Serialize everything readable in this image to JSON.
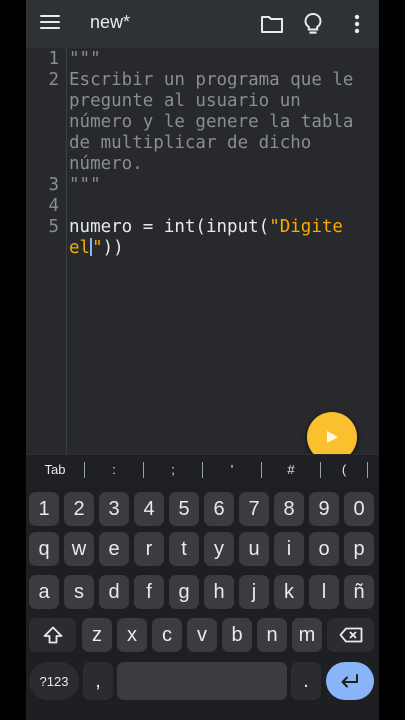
{
  "app": {
    "title": "new*",
    "icons": [
      "menu-icon",
      "folder-icon",
      "lightbulb-icon",
      "more-vert-icon"
    ]
  },
  "editor": {
    "lines": [
      {
        "n": "1",
        "text": "\"\"\""
      },
      {
        "n": "2",
        "text": "Escribir un programa que le"
      },
      {
        "n": "",
        "text": "pregunte al usuario un"
      },
      {
        "n": "",
        "text": "número y le genere la tabla"
      },
      {
        "n": "",
        "text": "de multiplicar de dicho"
      },
      {
        "n": "",
        "text": "número."
      },
      {
        "n": "3",
        "text": "\"\"\""
      },
      {
        "n": "4",
        "text": ""
      },
      {
        "n": "5",
        "text": ""
      }
    ],
    "code_line5": {
      "before": "numero = int(input(",
      "string_part1": "\"Digite",
      "string_part2": "el",
      "string_part3": "\"",
      "after": "))"
    }
  },
  "run_button": {
    "icon": "play-icon"
  },
  "symbol_bar": [
    "Tab",
    ":",
    ";",
    "'",
    "#",
    "("
  ],
  "keyboard": {
    "numbers": [
      "1",
      "2",
      "3",
      "4",
      "5",
      "6",
      "7",
      "8",
      "9",
      "0"
    ],
    "row1": [
      "q",
      "w",
      "e",
      "r",
      "t",
      "y",
      "u",
      "i",
      "o",
      "p"
    ],
    "row2": [
      "a",
      "s",
      "d",
      "f",
      "g",
      "h",
      "j",
      "k",
      "l",
      "ñ"
    ],
    "row3": [
      "z",
      "x",
      "c",
      "v",
      "b",
      "n",
      "m"
    ],
    "mode_key": "?123",
    "comma": ",",
    "period": ".",
    "shift_icon": "shift-icon",
    "backspace_icon": "backspace-icon",
    "enter_icon": "enter-icon"
  },
  "colors": {
    "accent": "#fbc02d",
    "string": "#f9ab00",
    "enter": "#8ab4f8"
  }
}
